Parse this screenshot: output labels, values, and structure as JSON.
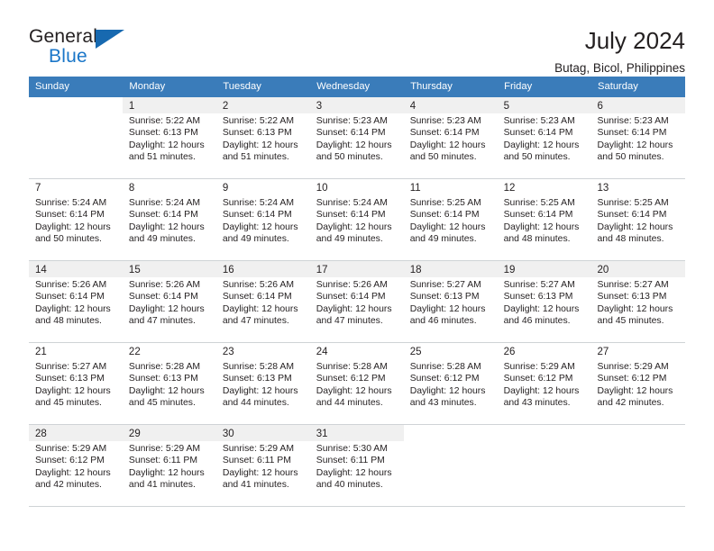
{
  "brand": {
    "line1": "General",
    "line2": "Blue",
    "accent_color": "#1a76c8",
    "triangle_color": "#1769b0"
  },
  "header": {
    "title": "July 2024",
    "subtitle": "Butag, Bicol, Philippines",
    "header_bg": "#3a7cba"
  },
  "weekdays": [
    "Sunday",
    "Monday",
    "Tuesday",
    "Wednesday",
    "Thursday",
    "Friday",
    "Saturday"
  ],
  "weeks": [
    [
      {
        "day": "",
        "sunrise": "",
        "sunset": "",
        "daylight1": "",
        "daylight2": ""
      },
      {
        "day": "1",
        "sunrise": "Sunrise: 5:22 AM",
        "sunset": "Sunset: 6:13 PM",
        "daylight1": "Daylight: 12 hours",
        "daylight2": "and 51 minutes."
      },
      {
        "day": "2",
        "sunrise": "Sunrise: 5:22 AM",
        "sunset": "Sunset: 6:13 PM",
        "daylight1": "Daylight: 12 hours",
        "daylight2": "and 51 minutes."
      },
      {
        "day": "3",
        "sunrise": "Sunrise: 5:23 AM",
        "sunset": "Sunset: 6:14 PM",
        "daylight1": "Daylight: 12 hours",
        "daylight2": "and 50 minutes."
      },
      {
        "day": "4",
        "sunrise": "Sunrise: 5:23 AM",
        "sunset": "Sunset: 6:14 PM",
        "daylight1": "Daylight: 12 hours",
        "daylight2": "and 50 minutes."
      },
      {
        "day": "5",
        "sunrise": "Sunrise: 5:23 AM",
        "sunset": "Sunset: 6:14 PM",
        "daylight1": "Daylight: 12 hours",
        "daylight2": "and 50 minutes."
      },
      {
        "day": "6",
        "sunrise": "Sunrise: 5:23 AM",
        "sunset": "Sunset: 6:14 PM",
        "daylight1": "Daylight: 12 hours",
        "daylight2": "and 50 minutes."
      }
    ],
    [
      {
        "day": "7",
        "sunrise": "Sunrise: 5:24 AM",
        "sunset": "Sunset: 6:14 PM",
        "daylight1": "Daylight: 12 hours",
        "daylight2": "and 50 minutes."
      },
      {
        "day": "8",
        "sunrise": "Sunrise: 5:24 AM",
        "sunset": "Sunset: 6:14 PM",
        "daylight1": "Daylight: 12 hours",
        "daylight2": "and 49 minutes."
      },
      {
        "day": "9",
        "sunrise": "Sunrise: 5:24 AM",
        "sunset": "Sunset: 6:14 PM",
        "daylight1": "Daylight: 12 hours",
        "daylight2": "and 49 minutes."
      },
      {
        "day": "10",
        "sunrise": "Sunrise: 5:24 AM",
        "sunset": "Sunset: 6:14 PM",
        "daylight1": "Daylight: 12 hours",
        "daylight2": "and 49 minutes."
      },
      {
        "day": "11",
        "sunrise": "Sunrise: 5:25 AM",
        "sunset": "Sunset: 6:14 PM",
        "daylight1": "Daylight: 12 hours",
        "daylight2": "and 49 minutes."
      },
      {
        "day": "12",
        "sunrise": "Sunrise: 5:25 AM",
        "sunset": "Sunset: 6:14 PM",
        "daylight1": "Daylight: 12 hours",
        "daylight2": "and 48 minutes."
      },
      {
        "day": "13",
        "sunrise": "Sunrise: 5:25 AM",
        "sunset": "Sunset: 6:14 PM",
        "daylight1": "Daylight: 12 hours",
        "daylight2": "and 48 minutes."
      }
    ],
    [
      {
        "day": "14",
        "sunrise": "Sunrise: 5:26 AM",
        "sunset": "Sunset: 6:14 PM",
        "daylight1": "Daylight: 12 hours",
        "daylight2": "and 48 minutes."
      },
      {
        "day": "15",
        "sunrise": "Sunrise: 5:26 AM",
        "sunset": "Sunset: 6:14 PM",
        "daylight1": "Daylight: 12 hours",
        "daylight2": "and 47 minutes."
      },
      {
        "day": "16",
        "sunrise": "Sunrise: 5:26 AM",
        "sunset": "Sunset: 6:14 PM",
        "daylight1": "Daylight: 12 hours",
        "daylight2": "and 47 minutes."
      },
      {
        "day": "17",
        "sunrise": "Sunrise: 5:26 AM",
        "sunset": "Sunset: 6:14 PM",
        "daylight1": "Daylight: 12 hours",
        "daylight2": "and 47 minutes."
      },
      {
        "day": "18",
        "sunrise": "Sunrise: 5:27 AM",
        "sunset": "Sunset: 6:13 PM",
        "daylight1": "Daylight: 12 hours",
        "daylight2": "and 46 minutes."
      },
      {
        "day": "19",
        "sunrise": "Sunrise: 5:27 AM",
        "sunset": "Sunset: 6:13 PM",
        "daylight1": "Daylight: 12 hours",
        "daylight2": "and 46 minutes."
      },
      {
        "day": "20",
        "sunrise": "Sunrise: 5:27 AM",
        "sunset": "Sunset: 6:13 PM",
        "daylight1": "Daylight: 12 hours",
        "daylight2": "and 45 minutes."
      }
    ],
    [
      {
        "day": "21",
        "sunrise": "Sunrise: 5:27 AM",
        "sunset": "Sunset: 6:13 PM",
        "daylight1": "Daylight: 12 hours",
        "daylight2": "and 45 minutes."
      },
      {
        "day": "22",
        "sunrise": "Sunrise: 5:28 AM",
        "sunset": "Sunset: 6:13 PM",
        "daylight1": "Daylight: 12 hours",
        "daylight2": "and 45 minutes."
      },
      {
        "day": "23",
        "sunrise": "Sunrise: 5:28 AM",
        "sunset": "Sunset: 6:13 PM",
        "daylight1": "Daylight: 12 hours",
        "daylight2": "and 44 minutes."
      },
      {
        "day": "24",
        "sunrise": "Sunrise: 5:28 AM",
        "sunset": "Sunset: 6:12 PM",
        "daylight1": "Daylight: 12 hours",
        "daylight2": "and 44 minutes."
      },
      {
        "day": "25",
        "sunrise": "Sunrise: 5:28 AM",
        "sunset": "Sunset: 6:12 PM",
        "daylight1": "Daylight: 12 hours",
        "daylight2": "and 43 minutes."
      },
      {
        "day": "26",
        "sunrise": "Sunrise: 5:29 AM",
        "sunset": "Sunset: 6:12 PM",
        "daylight1": "Daylight: 12 hours",
        "daylight2": "and 43 minutes."
      },
      {
        "day": "27",
        "sunrise": "Sunrise: 5:29 AM",
        "sunset": "Sunset: 6:12 PM",
        "daylight1": "Daylight: 12 hours",
        "daylight2": "and 42 minutes."
      }
    ],
    [
      {
        "day": "28",
        "sunrise": "Sunrise: 5:29 AM",
        "sunset": "Sunset: 6:12 PM",
        "daylight1": "Daylight: 12 hours",
        "daylight2": "and 42 minutes."
      },
      {
        "day": "29",
        "sunrise": "Sunrise: 5:29 AM",
        "sunset": "Sunset: 6:11 PM",
        "daylight1": "Daylight: 12 hours",
        "daylight2": "and 41 minutes."
      },
      {
        "day": "30",
        "sunrise": "Sunrise: 5:29 AM",
        "sunset": "Sunset: 6:11 PM",
        "daylight1": "Daylight: 12 hours",
        "daylight2": "and 41 minutes."
      },
      {
        "day": "31",
        "sunrise": "Sunrise: 5:30 AM",
        "sunset": "Sunset: 6:11 PM",
        "daylight1": "Daylight: 12 hours",
        "daylight2": "and 40 minutes."
      },
      {
        "day": "",
        "sunrise": "",
        "sunset": "",
        "daylight1": "",
        "daylight2": ""
      },
      {
        "day": "",
        "sunrise": "",
        "sunset": "",
        "daylight1": "",
        "daylight2": ""
      },
      {
        "day": "",
        "sunrise": "",
        "sunset": "",
        "daylight1": "",
        "daylight2": ""
      }
    ]
  ]
}
